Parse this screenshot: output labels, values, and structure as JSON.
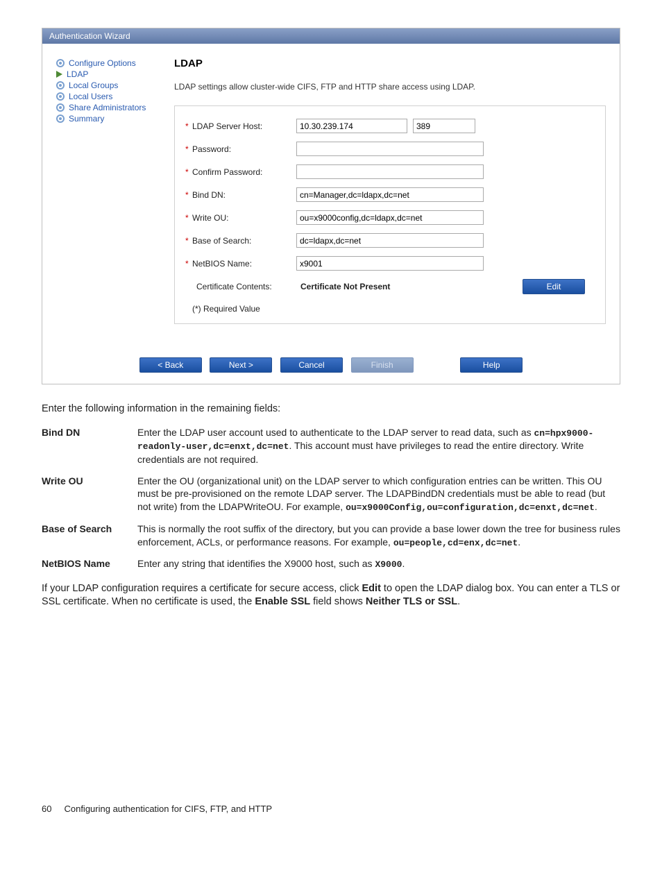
{
  "wizard": {
    "title": "Authentication Wizard",
    "nav": [
      {
        "label": "Configure Options",
        "kind": "bullet"
      },
      {
        "label": "LDAP",
        "kind": "arrow"
      },
      {
        "label": "Local Groups",
        "kind": "bullet"
      },
      {
        "label": "Local Users",
        "kind": "bullet"
      },
      {
        "label": "Share Administrators",
        "kind": "bullet"
      },
      {
        "label": "Summary",
        "kind": "bullet"
      }
    ],
    "heading": "LDAP",
    "description": "LDAP settings allow cluster-wide CIFS, FTP and HTTP share access using LDAP.",
    "fields": {
      "ldap_host_label": "LDAP Server Host:",
      "ldap_host_value": "10.30.239.174",
      "ldap_port_value": "389",
      "password_label": "Password:",
      "password_value": "",
      "confirm_label": "Confirm Password:",
      "confirm_value": "",
      "bind_dn_label": "Bind DN:",
      "bind_dn_value": "cn=Manager,dc=ldapx,dc=net",
      "write_ou_label": "Write OU:",
      "write_ou_value": "ou=x9000config,dc=ldapx,dc=net",
      "base_label": "Base of Search:",
      "base_value": "dc=ldapx,dc=net",
      "netbios_label": "NetBIOS Name:",
      "netbios_value": "x9001",
      "cert_label": "Certificate Contents:",
      "cert_value": "Certificate Not Present",
      "edit_button": "Edit",
      "required_note": "(*) Required Value"
    },
    "footer": {
      "back": "< Back",
      "next": "Next >",
      "cancel": "Cancel",
      "finish": "Finish",
      "help": "Help"
    }
  },
  "doc": {
    "lead": "Enter the following information in the remaining fields:",
    "defs": [
      {
        "term": "Bind DN",
        "pre": "Enter the LDAP user account used to authenticate to the LDAP server to read data, such as ",
        "code": "cn=hpx9000-readonly-user,dc=enxt,dc=net",
        "post": ". This account must have privileges to read the entire directory. Write credentials are not required."
      },
      {
        "term": "Write OU",
        "pre": "Enter the OU (organizational unit) on the LDAP server to which configuration entries can be written. This OU must be pre-provisioned on the remote LDAP server. The LDAPBindDN credentials must be able to read (but not write) from the LDAPWriteOU. For example, ",
        "code": "ou=x9000Config,ou=configuration,dc=enxt,dc=net",
        "post": "."
      },
      {
        "term": "Base of Search",
        "pre": "This is normally the root suffix of the directory, but you can provide a base lower down the tree for business rules enforcement, ACLs, or performance reasons. For example, ",
        "code": "ou=people,cd=enx,dc=net",
        "post": "."
      },
      {
        "term": "NetBIOS Name",
        "pre": "Enter any string that identifies the X9000 host, such as ",
        "code": "X9000",
        "post": "."
      }
    ],
    "closing_a": "If your LDAP configuration requires a certificate for secure access, click ",
    "closing_edit": "Edit",
    "closing_b": " to open the LDAP dialog box. You can enter a TLS or SSL certificate. When no certificate is used, the ",
    "closing_enable": "Enable SSL",
    "closing_c": " field shows ",
    "closing_neither": "Neither TLS or SSL",
    "closing_d": "."
  },
  "footer": {
    "page_no": "60",
    "chapter": "Configuring authentication for CIFS, FTP, and HTTP"
  }
}
